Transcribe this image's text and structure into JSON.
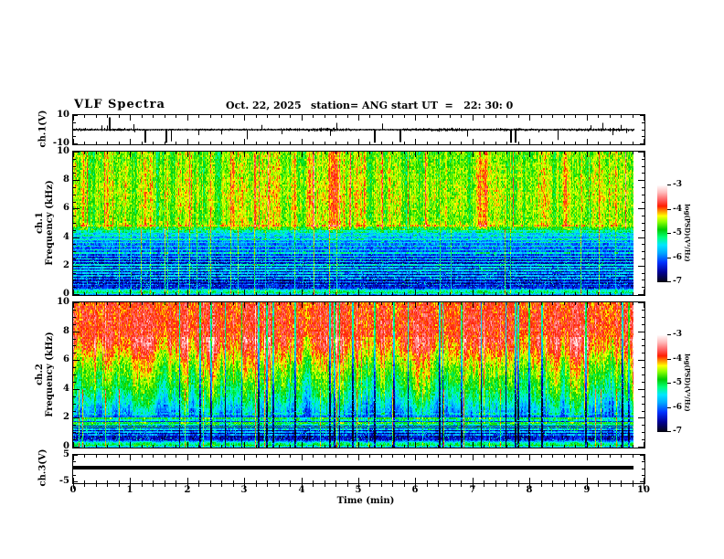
{
  "header": {
    "title": "VLF Spectra",
    "date": "Oct. 22, 2025",
    "station": "station= ANG",
    "start_ut": "start UT  =   22: 30: 0"
  },
  "xaxis": {
    "label": "Time (min)",
    "ticks": [
      "0",
      "1",
      "2",
      "3",
      "4",
      "5",
      "6",
      "7",
      "8",
      "9",
      "10"
    ]
  },
  "panels": {
    "ch1v": {
      "ylabel": "ch.1(V)",
      "yticks": [
        "10",
        "-10"
      ]
    },
    "spec1": {
      "ylabel1": "ch.1",
      "ylabel2": "Frequency (kHz)",
      "yticks": [
        "10",
        "8",
        "6",
        "4",
        "2",
        "0"
      ]
    },
    "spec2": {
      "ylabel1": "ch.2",
      "ylabel2": "Frequency (kHz)",
      "yticks": [
        "10",
        "8",
        "6",
        "4",
        "2",
        "0"
      ]
    },
    "ch3v": {
      "ylabel": "ch.3(V)",
      "yticks": [
        "5",
        "-5"
      ]
    }
  },
  "colorbar": {
    "label": "log(PSD)(V²/Hz)",
    "ticks": [
      "-3",
      "-4",
      "-5",
      "-6",
      "-7"
    ],
    "zlim": [
      -7,
      -3
    ],
    "palette": [
      [
        0,
        "#050514"
      ],
      [
        0.1,
        "#000096"
      ],
      [
        0.2,
        "#0032ff"
      ],
      [
        0.3,
        "#00aaff"
      ],
      [
        0.38,
        "#00e6ff"
      ],
      [
        0.46,
        "#00ff78"
      ],
      [
        0.54,
        "#00cd00"
      ],
      [
        0.62,
        "#8cff00"
      ],
      [
        0.68,
        "#ffff00"
      ],
      [
        0.73,
        "#ff9100"
      ],
      [
        0.78,
        "#ff1e00"
      ],
      [
        0.84,
        "#ff5a5a"
      ],
      [
        0.92,
        "#ffb9b9"
      ],
      [
        1,
        "#ffffff"
      ]
    ]
  },
  "chart_data": [
    {
      "id": "ch1_waveform",
      "type": "line",
      "ylabel": "ch.1(V)",
      "xlim": [
        0,
        10
      ],
      "ylim": [
        -10,
        10
      ],
      "x_end": 9.83,
      "noise_rms_v": 0.9,
      "spikes": [
        {
          "t": 0.62,
          "v": 9
        },
        {
          "t": 1.05,
          "v": 4
        },
        {
          "t": 1.25,
          "v": -9.5
        },
        {
          "t": 1.62,
          "v": -9.5
        },
        {
          "t": 1.71,
          "v": -8.5
        },
        {
          "t": 2.2,
          "v": -4
        },
        {
          "t": 2.6,
          "v": -3.5
        },
        {
          "t": 3.05,
          "v": -7
        },
        {
          "t": 3.3,
          "v": 3.5
        },
        {
          "t": 4.5,
          "v": -4.5
        },
        {
          "t": 4.62,
          "v": 5
        },
        {
          "t": 5.28,
          "v": -9.5
        },
        {
          "t": 5.42,
          "v": 4.5
        },
        {
          "t": 5.72,
          "v": -9
        },
        {
          "t": 6.9,
          "v": -5
        },
        {
          "t": 7.66,
          "v": -9.5
        },
        {
          "t": 7.74,
          "v": -9.5
        },
        {
          "t": 8.5,
          "v": -7.5
        },
        {
          "t": 9.28,
          "v": 5
        },
        {
          "t": 9.45,
          "v": -4
        },
        {
          "t": 9.6,
          "v": 3.5
        }
      ]
    },
    {
      "id": "ch1_spectrogram",
      "type": "heatmap",
      "ylabel": "ch.1 Frequency (kHz)",
      "ylim": [
        0,
        10
      ],
      "zlim": [
        -7,
        -3
      ],
      "z_units": "log(PSD)(V²/Hz)",
      "x_end": 9.83,
      "bands": [
        {
          "f_range": [
            4.7,
            10
          ],
          "level_log_psd": -4.5,
          "note": "yellow-green, dense red/orange vertical streaks"
        },
        {
          "f_range": [
            2.6,
            4.7
          ],
          "level_log_psd": -5.9,
          "note": "blue with many cyan horizontal lines, yellow sferic verticals"
        },
        {
          "f_range": [
            0.4,
            2.6
          ],
          "level_log_psd": -6.5,
          "note": "dark navy, sparse cyan lines"
        },
        {
          "f_range": [
            0,
            0.4
          ],
          "level_log_psd": -5.2,
          "note": "bright speckled bottom row"
        }
      ],
      "profile": [
        [
          0,
          -5.9
        ],
        [
          0.12,
          -5.1
        ],
        [
          0.3,
          -5.35
        ],
        [
          0.45,
          -6.3
        ],
        [
          0.8,
          -6.55
        ],
        [
          1.2,
          -6.6
        ],
        [
          1.6,
          -6.5
        ],
        [
          2.0,
          -6.55
        ],
        [
          2.4,
          -6.45
        ],
        [
          2.8,
          -6.2
        ],
        [
          3.2,
          -6.05
        ],
        [
          3.6,
          -5.95
        ],
        [
          4.0,
          -5.75
        ],
        [
          4.3,
          -5.6
        ],
        [
          4.55,
          -5.2
        ],
        [
          4.75,
          -4.7
        ],
        [
          4.95,
          -4.5
        ],
        [
          5.3,
          -4.6
        ],
        [
          6,
          -4.55
        ],
        [
          7,
          -4.5
        ],
        [
          8,
          -4.55
        ],
        [
          9,
          -4.6
        ],
        [
          10,
          -4.65
        ]
      ],
      "hlines": [
        [
          4.85,
          -4.35
        ],
        [
          4.6,
          -4.9
        ],
        [
          4.4,
          -5.2
        ],
        [
          4.15,
          -5.45
        ],
        [
          3.9,
          -5.35
        ],
        [
          3.65,
          -5.5
        ],
        [
          3.4,
          -5.45
        ],
        [
          3.15,
          -5.55
        ],
        [
          2.9,
          -5.4
        ],
        [
          2.7,
          -5.6
        ],
        [
          2.5,
          -5.55
        ],
        [
          2.3,
          -5.65
        ],
        [
          2.1,
          -5.5
        ],
        [
          1.9,
          -5.7
        ],
        [
          1.7,
          -5.55
        ],
        [
          1.5,
          -5.8
        ],
        [
          1.3,
          -5.75
        ],
        [
          1.1,
          -5.9
        ],
        [
          0.9,
          -6.0
        ],
        [
          0.7,
          -6.1
        ]
      ],
      "streaks": {
        "seed": 11,
        "burst_prob": 0.05,
        "burst_amp": 0.55,
        "a_band": [
          4.6,
          10
        ],
        "a_out": 0.2,
        "sferic_prob": 0.04,
        "sferic_amp": 1.0,
        "b_max": 4.6,
        "b_out": 0.35,
        "dark_prob": 0
      }
    },
    {
      "id": "ch2_spectrogram",
      "type": "heatmap",
      "ylabel": "ch.2 Frequency (kHz)",
      "ylim": [
        0,
        10
      ],
      "zlim": [
        -7,
        -3
      ],
      "z_units": "log(PSD)(V²/Hz)",
      "x_end": 9.83,
      "bands": [
        {
          "f_range": [
            7,
            10
          ],
          "level_log_psd": -3.9,
          "note": "saturated red/orange with pale streaks and black vertical dropouts"
        },
        {
          "f_range": [
            4.5,
            7
          ],
          "level_log_psd": -4.6,
          "note": "yellow-green gradient with red streaks"
        },
        {
          "f_range": [
            2.2,
            4.5
          ],
          "level_log_psd": -5.4,
          "note": "green-cyan-blue streaked"
        },
        {
          "f_range": [
            0.4,
            2.2
          ],
          "level_log_psd": -6.4,
          "note": "dark navy with bright yellow/cyan horizontal lines near 1.4-2 kHz"
        },
        {
          "f_range": [
            0,
            0.4
          ],
          "level_log_psd": -5.2,
          "note": "bright speckled bottom row"
        }
      ],
      "profile": [
        [
          0,
          -5.7
        ],
        [
          0.12,
          -5.0
        ],
        [
          0.3,
          -5.3
        ],
        [
          0.5,
          -6.4
        ],
        [
          0.8,
          -6.6
        ],
        [
          1.1,
          -6.55
        ],
        [
          1.5,
          -6.35
        ],
        [
          1.9,
          -6.15
        ],
        [
          2.3,
          -5.9
        ],
        [
          2.7,
          -5.65
        ],
        [
          3.1,
          -5.45
        ],
        [
          3.5,
          -5.25
        ],
        [
          4.0,
          -5.05
        ],
        [
          4.5,
          -4.9
        ],
        [
          5.0,
          -4.75
        ],
        [
          5.5,
          -4.6
        ],
        [
          6.0,
          -4.4
        ],
        [
          6.5,
          -4.2
        ],
        [
          7.0,
          -4.0
        ],
        [
          7.5,
          -3.9
        ],
        [
          8.5,
          -3.85
        ],
        [
          9.5,
          -3.9
        ],
        [
          10,
          -3.95
        ]
      ],
      "hlines": [
        [
          2.0,
          -5.0
        ],
        [
          1.85,
          -5.4
        ],
        [
          1.7,
          -4.9
        ],
        [
          1.55,
          -5.3
        ],
        [
          1.4,
          -5.1
        ],
        [
          1.25,
          -5.6
        ],
        [
          1.05,
          -5.8
        ],
        [
          0.85,
          -6.0
        ],
        [
          2.3,
          -5.6
        ],
        [
          2.6,
          -5.8
        ]
      ],
      "streaks": {
        "seed": 77,
        "burst_prob": 0.06,
        "burst_amp": 0.5,
        "a_band": [
          2.2,
          7.6
        ],
        "a_out": 0.35,
        "sferic_prob": 0.035,
        "sferic_amp": 1.0,
        "b_max": 4.0,
        "b_out": 0.25,
        "dark_prob": 0.035
      }
    },
    {
      "id": "ch3_waveform",
      "type": "line",
      "ylabel": "ch.3(V)",
      "xlim": [
        0,
        10
      ],
      "ylim": [
        -5,
        5
      ],
      "x_end": 9.83,
      "value_v": 0.3,
      "note": "constant flat thick line"
    }
  ]
}
